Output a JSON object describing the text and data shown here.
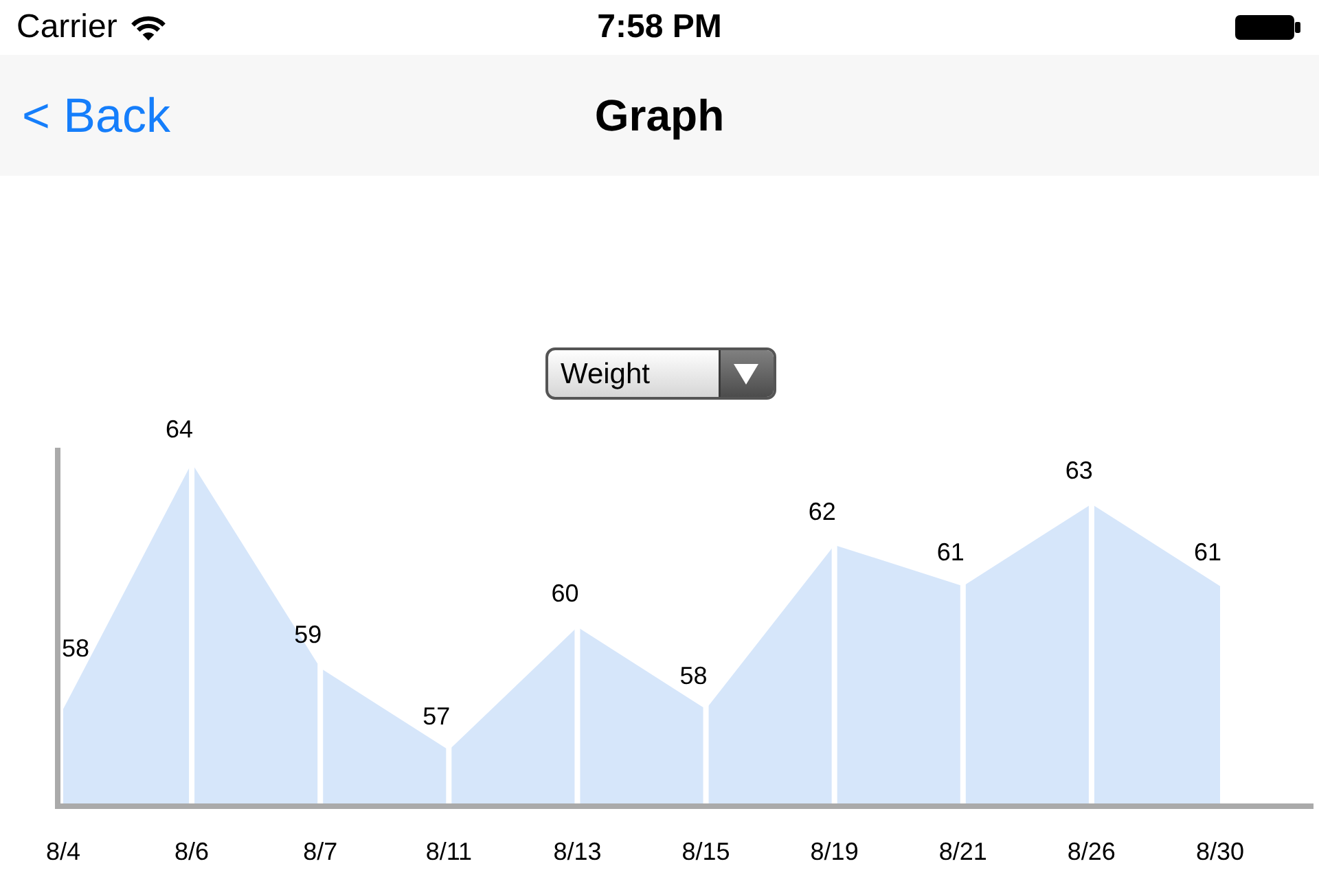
{
  "status_bar": {
    "carrier": "Carrier",
    "time": "7:58 PM"
  },
  "nav_bar": {
    "back": "< Back",
    "title": "Graph"
  },
  "metric_selector": {
    "value": "Weight"
  },
  "chart": {
    "chart_data": {
      "type": "area",
      "categories": [
        "8/4",
        "8/6",
        "8/7",
        "8/11",
        "8/13",
        "8/15",
        "8/19",
        "8/21",
        "8/26",
        "8/30"
      ],
      "series": [
        {
          "color": "#d6e6fa",
          "values": [
            58,
            64,
            59,
            57,
            60,
            58,
            62,
            61,
            63,
            61
          ]
        }
      ],
      "data_labels": true
    }
  }
}
